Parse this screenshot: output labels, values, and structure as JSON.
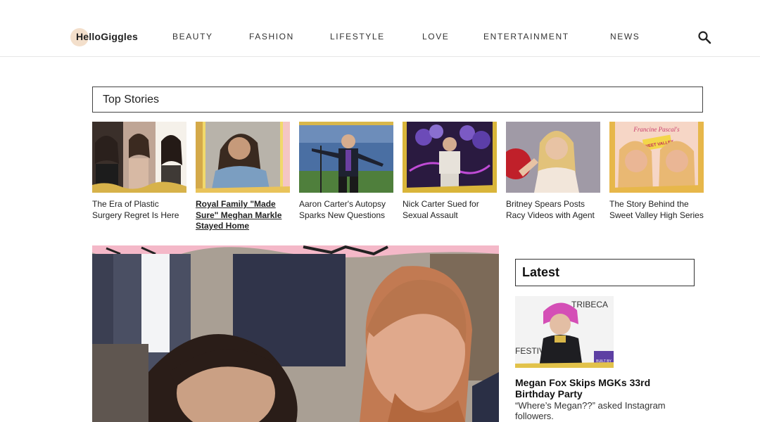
{
  "header": {
    "logo_text": "HelloGiggles",
    "nav": [
      "BEAUTY",
      "FASHION",
      "LIFESTYLE",
      "LOVE",
      "ENTERTAINMENT",
      "NEWS"
    ]
  },
  "top_stories": {
    "heading": "Top Stories",
    "items": [
      {
        "title": "The Era of Plastic Surgery Regret Is Here"
      },
      {
        "title": "Royal Family \"Made Sure\" Meghan Markle Stayed Home"
      },
      {
        "title": "Aaron Carter's Autopsy Sparks New Questions"
      },
      {
        "title": "Nick Carter Sued for Sexual Assault"
      },
      {
        "title": "Britney Spears Posts Racy Videos with Agent"
      },
      {
        "title": "The Story Behind the Sweet Valley High Series"
      }
    ]
  },
  "latest": {
    "heading": "Latest",
    "items": [
      {
        "title": "Megan Fox Skips MGKs 33rd Birthday Party",
        "description": "“Where’s Megan??” asked Instagram followers."
      }
    ]
  },
  "thumb_text": {
    "tribeca": "TRIBECA",
    "festival": "FESTIVAL",
    "built_by": "BUILT BY",
    "francine": "Francine Pascal's",
    "sweet_valley": "SWEET VALLEY"
  }
}
